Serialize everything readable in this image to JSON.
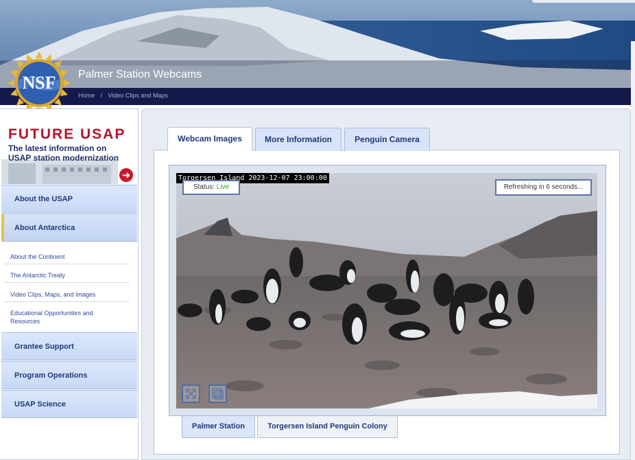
{
  "header": {
    "title": "Palmer Station Webcams",
    "breadcrumb": [
      "Home",
      "/",
      "Video Clips and Maps"
    ]
  },
  "logo": {
    "text": "NSF"
  },
  "promo": {
    "title": "FUTURE USAP",
    "subtitle": "The latest information on USAP station modernization"
  },
  "sidebar": {
    "items": [
      {
        "label": "About the USAP"
      },
      {
        "label": "About Antarctica"
      },
      {
        "label": "Grantee Support"
      },
      {
        "label": "Program Operations"
      },
      {
        "label": "USAP Science"
      }
    ],
    "subitems": [
      {
        "label": "About the Continent"
      },
      {
        "label": "The Antarctic Treaty"
      },
      {
        "label": "Video Clips, Maps, and Images"
      },
      {
        "label": "Educational Opportunities and Resources"
      }
    ]
  },
  "tabs": [
    {
      "label": "Webcam Images"
    },
    {
      "label": "More Information"
    },
    {
      "label": "Penguin Camera"
    }
  ],
  "camera": {
    "stamp": "Torgersen Island 2023-12-07 23:00:00",
    "status_label": "Status:",
    "status_value": "Live",
    "refresh_text": "Refreshing in 6 seconds..."
  },
  "bottom_tabs": [
    {
      "label": "Palmer Station"
    },
    {
      "label": "Torgersen Island Penguin Colony"
    }
  ],
  "colors": {
    "nav_bg": "#d0def7",
    "accent": "#b3142a",
    "active_marker": "#e8c23a",
    "link": "#2d4a94"
  }
}
